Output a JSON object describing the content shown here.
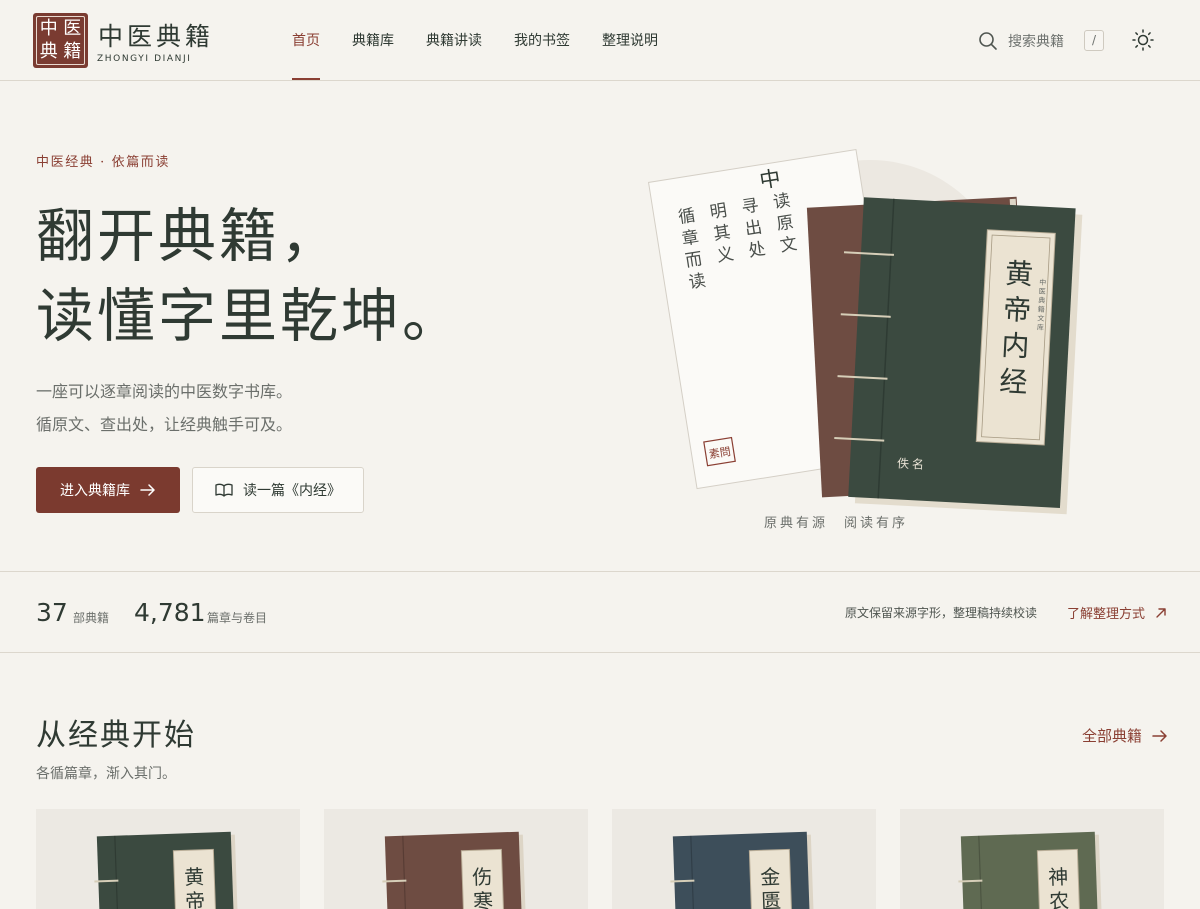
{
  "brand": {
    "seal_chars": [
      "中",
      "医",
      "典",
      "籍"
    ],
    "name": "中医典籍",
    "subtitle": "ZHONGYI DIANJI"
  },
  "nav": {
    "items": [
      {
        "label": "首页",
        "active": true
      },
      {
        "label": "典籍库",
        "active": false
      },
      {
        "label": "典籍讲读",
        "active": false
      },
      {
        "label": "我的书签",
        "active": false
      },
      {
        "label": "整理说明",
        "active": false
      }
    ]
  },
  "search": {
    "placeholder": "搜索典籍",
    "shortcut": "/",
    "icon": "search-icon"
  },
  "theme_toggle": {
    "icon": "sun-icon"
  },
  "hero": {
    "eyebrow": "中医经典 · 依篇而读",
    "title_line1": "翻开典籍，",
    "title_line2": "读懂字里乾坤。",
    "desc_line1": "一座可以逐章阅读的中医数字书库。",
    "desc_line2": "循原文、查出处，让经典触手可及。",
    "primary_button": "进入典籍库",
    "secondary_button": "读一篇《内经》",
    "caption": "原典有源　阅读有序",
    "illustration": {
      "page_columns": [
        "读原文",
        "寻出处",
        "明其义",
        "循章而读"
      ],
      "page_peek_char": "中",
      "page_seal": "素問",
      "book_title": "黄帝内经",
      "book_side_label": "中医典籍文库",
      "book_author": "佚名",
      "colors": {
        "front_book": "#3b4a40",
        "back_book": "#6e4c42",
        "label_paper": "#ebe3d2"
      }
    }
  },
  "stats": {
    "books_count": "37",
    "books_label": "部典籍",
    "chapters_count": "4,781",
    "chapters_label": "篇章与卷目",
    "note": "原文保留来源字形，整理稿持续校读",
    "link": "了解整理方式"
  },
  "section": {
    "title": "从经典开始",
    "subtitle": "各循篇章，渐入其门。",
    "link": "全部典籍",
    "cards": [
      {
        "char1": "黄",
        "char2": "帝",
        "color": "#3b4a40"
      },
      {
        "char1": "伤",
        "char2": "寒",
        "color": "#6e4c42"
      },
      {
        "char1": "金",
        "char2": "匮",
        "color": "#3d4e5a"
      },
      {
        "char1": "神",
        "char2": "农",
        "color": "#5f6a52"
      }
    ]
  },
  "colors": {
    "accent": "#7b3a2f",
    "background": "#f5f3ee",
    "text": "#2f3a33"
  }
}
